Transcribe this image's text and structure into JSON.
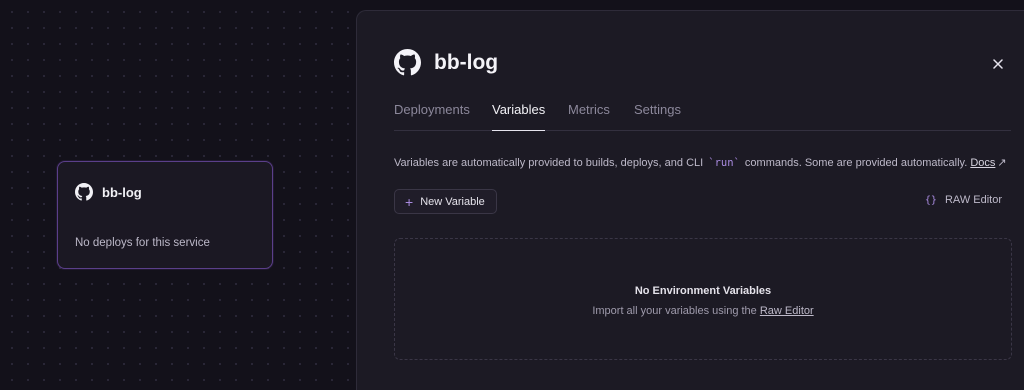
{
  "canvas": {
    "service_card": {
      "name": "bb-log",
      "status": "No deploys for this service",
      "icon": "github-icon"
    }
  },
  "panel": {
    "title": "bb-log",
    "icon": "github-icon",
    "close_icon": "close-icon",
    "tabs": [
      {
        "label": "Deployments",
        "active": false
      },
      {
        "label": "Variables",
        "active": true
      },
      {
        "label": "Metrics",
        "active": false
      },
      {
        "label": "Settings",
        "active": false
      }
    ],
    "description": {
      "before": "Variables are automatically provided to builds, deploys, and CLI ",
      "code": "`run`",
      "after": " commands. Some are provided automatically. ",
      "link": "Docs",
      "link_icon": "↗"
    },
    "new_variable_label": "New Variable",
    "new_variable_icon": "+",
    "raw_editor_label": "RAW Editor",
    "raw_editor_icon": "{}",
    "empty": {
      "title": "No Environment Variables",
      "subtitle_before": "Import all your variables using the ",
      "subtitle_link": "Raw Editor"
    }
  },
  "colors": {
    "background": "#13111a",
    "panel": "#1c1a24",
    "accent": "#a98be0",
    "card_border": "#5b3f8a"
  }
}
